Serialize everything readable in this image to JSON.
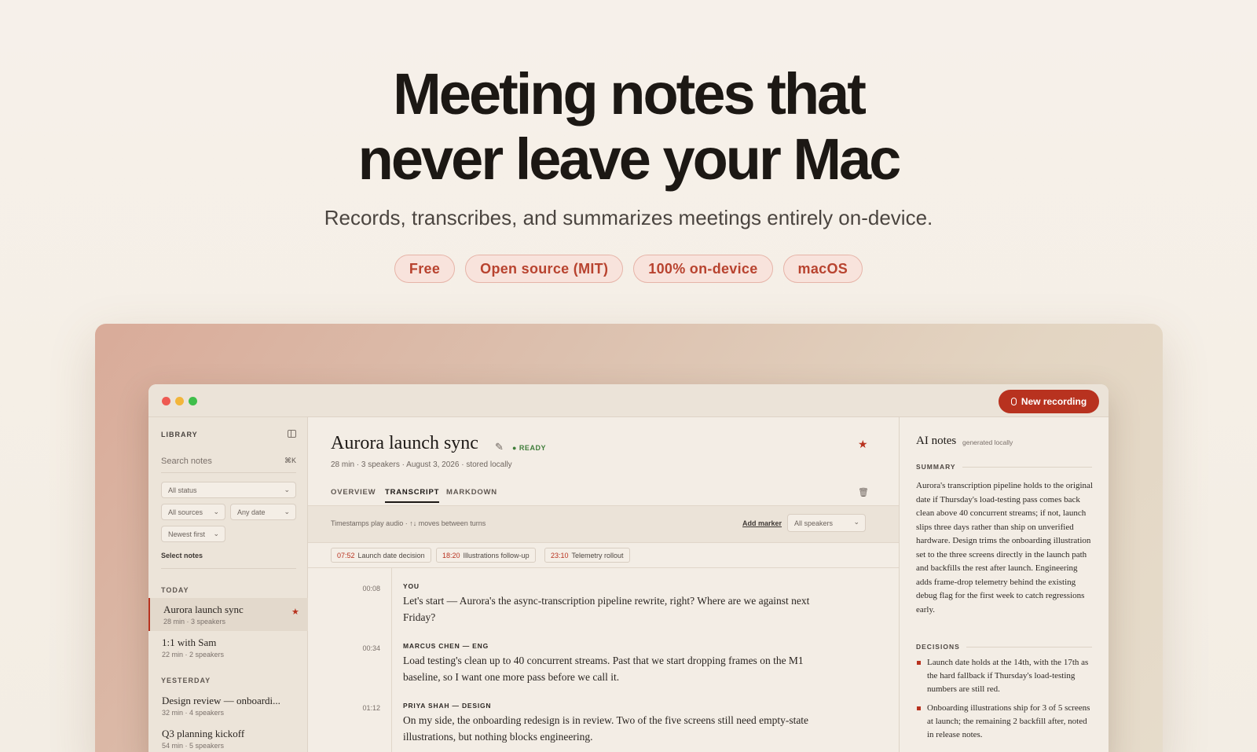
{
  "hero": {
    "title_line1": "Meeting notes that",
    "title_line2": "never leave your Mac",
    "subtitle": "Records, transcribes, and summarizes meetings entirely on-device.",
    "pills": [
      "Free",
      "Open source (MIT)",
      "100% on-device",
      "macOS"
    ]
  },
  "app": {
    "new_recording": "New recording",
    "sidebar": {
      "library_label": "LIBRARY",
      "search_placeholder": "Search notes",
      "search_shortcut": "⌘K",
      "filter_status": "All status",
      "filter_sources": "All sources",
      "filter_date": "Any date",
      "sort": "Newest first",
      "select_notes": "Select notes",
      "groups": [
        {
          "label": "TODAY",
          "items": [
            {
              "title": "Aurora launch sync",
              "meta": "28 min · 3 speakers",
              "starred": true
            },
            {
              "title": "1:1 with Sam",
              "meta": "22 min · 2 speakers"
            }
          ]
        },
        {
          "label": "YESTERDAY",
          "items": [
            {
              "title": "Design review — onboardi...",
              "meta": "32 min · 4 speakers"
            },
            {
              "title": "Q3 planning kickoff",
              "meta": "54 min · 5 speakers"
            }
          ]
        }
      ]
    },
    "note": {
      "title": "Aurora launch sync",
      "status": "● READY",
      "meta": "28 min · 3 speakers · August 3, 2026 · stored locally",
      "tabs": [
        "OVERVIEW",
        "TRANSCRIPT",
        "MARKDOWN"
      ],
      "active_tab": "TRANSCRIPT",
      "hint": "Timestamps play audio · ↑↓ moves between turns",
      "add_marker": "Add marker",
      "speaker_filter": "All speakers",
      "markers": [
        {
          "time": "07:52",
          "label": "Launch date decision"
        },
        {
          "time": "18:20",
          "label": "Illustrations follow-up"
        },
        {
          "time": "23:10",
          "label": "Telemetry rollout"
        }
      ],
      "transcript": [
        {
          "time": "00:08",
          "speaker": "YOU",
          "text": "Let's start — Aurora's the async-transcription pipeline rewrite, right? Where are we against next Friday?"
        },
        {
          "time": "00:34",
          "speaker": "MARCUS CHEN — ENG",
          "text": "Load testing's clean up to 40 concurrent streams. Past that we start dropping frames on the M1 baseline, so I want one more pass before we call it."
        },
        {
          "time": "01:12",
          "speaker": "PRIYA SHAH — DESIGN",
          "text": "On my side, the onboarding redesign is in review. Two of the five screens still need empty-state illustrations, but nothing blocks engineering."
        }
      ]
    },
    "ai_notes": {
      "title": "AI notes",
      "subtitle": "generated locally",
      "summary_label": "SUMMARY",
      "summary": "Aurora's transcription pipeline holds to the original date if Thursday's load-testing pass comes back clean above 40 concurrent streams; if not, launch slips three days rather than ship on unverified hardware. Design trims the onboarding illustration set to the three screens directly in the launch path and backfills the rest after launch. Engineering adds frame-drop telemetry behind the existing debug flag for the first week to catch regressions early.",
      "decisions_label": "DECISIONS",
      "decisions": [
        "Launch date holds at the 14th, with the 17th as the hard fallback if Thursday's load-testing numbers are still red.",
        "Onboarding illustrations ship for 3 of 5 screens at launch; the remaining 2 backfill after, noted in release notes."
      ]
    }
  },
  "colors": {
    "accent": "#b8321f",
    "ready": "#3f7d3a",
    "background": "#f5efe6"
  }
}
